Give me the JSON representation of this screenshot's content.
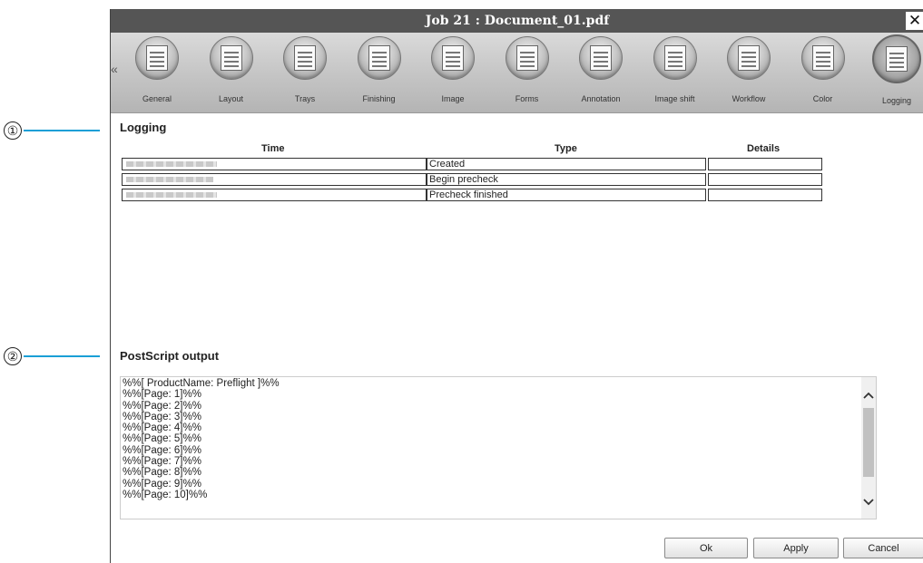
{
  "callouts": {
    "one": "①",
    "two": "②"
  },
  "window": {
    "title": "Job 21 : Document_01.pdf",
    "close_icon": "close-icon"
  },
  "toolbar": {
    "scroll_left": "«",
    "items": [
      {
        "label": "General",
        "icon": "general-icon"
      },
      {
        "label": "Layout",
        "icon": "layout-icon"
      },
      {
        "label": "Trays",
        "icon": "trays-icon"
      },
      {
        "label": "Finishing",
        "icon": "finishing-icon"
      },
      {
        "label": "Image",
        "icon": "image-icon"
      },
      {
        "label": "Forms",
        "icon": "forms-icon"
      },
      {
        "label": "Annotation",
        "icon": "annotation-icon"
      },
      {
        "label": "Image shift",
        "icon": "image-shift-icon"
      },
      {
        "label": "Workflow",
        "icon": "workflow-icon"
      },
      {
        "label": "Color",
        "icon": "color-icon"
      },
      {
        "label": "Logging",
        "icon": "logging-icon",
        "active": true
      }
    ]
  },
  "logging": {
    "title": "Logging",
    "columns": {
      "time": "Time",
      "type": "Type",
      "details": "Details"
    },
    "rows": [
      {
        "time": "",
        "type": "Created",
        "details": ""
      },
      {
        "time": "",
        "type": "Begin precheck",
        "details": ""
      },
      {
        "time": "",
        "type": "Precheck finished",
        "details": ""
      }
    ]
  },
  "postscript": {
    "title": "PostScript output",
    "lines": [
      "%%[ ProductName: Preflight ]%%",
      "%%[Page: 1]%%",
      "%%[Page: 2]%%",
      "%%[Page: 3]%%",
      "%%[Page: 4]%%",
      "%%[Page: 5]%%",
      "%%[Page: 6]%%",
      "%%[Page: 7]%%",
      "%%[Page: 8]%%",
      "%%[Page: 9]%%",
      "%%[Page: 10]%%"
    ],
    "scroll_up": "^",
    "scroll_down": "v"
  },
  "buttons": {
    "ok": "Ok",
    "apply": "Apply",
    "cancel": "Cancel"
  },
  "colors": {
    "titlebar": "#555555",
    "callout_line": "#1a9fd6"
  }
}
